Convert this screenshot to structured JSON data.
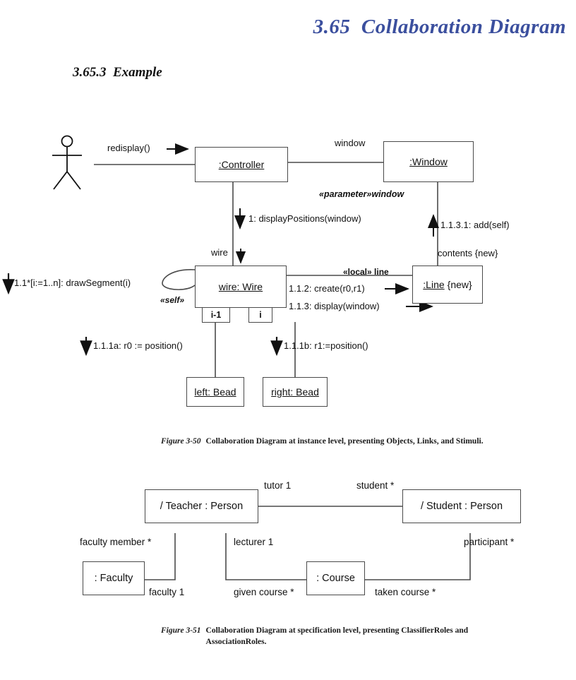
{
  "page": {
    "chapter_title": "3.65  Collaboration Diagram",
    "section_title": "3.65.3  Example",
    "title_color": "#3b4f9e"
  },
  "figure_instance": {
    "actor": {
      "name": "actor-stick-figure"
    },
    "objects": [
      {
        "id": "controller",
        "name": ":Controller",
        "tag": ""
      },
      {
        "id": "window",
        "name": ":Window",
        "tag": ""
      },
      {
        "id": "wire",
        "name": "wire: Wire",
        "tag": ""
      },
      {
        "id": "line",
        "name": ":Line",
        "tag": "{new}"
      },
      {
        "id": "left_bead",
        "name": "left: Bead",
        "tag": ""
      },
      {
        "id": "right_bead",
        "name": "right: Bead",
        "tag": ""
      }
    ],
    "sub_boxes": [
      {
        "id": "i_minus_1",
        "label": "i-1"
      },
      {
        "id": "i",
        "label": "i"
      }
    ],
    "messages": [
      {
        "id": "m0",
        "text": "redisplay()"
      },
      {
        "id": "m1",
        "text": "1: displayPositions(window)"
      },
      {
        "id": "m2",
        "text": "1.1*[i:=1..n]: drawSegment(i)"
      },
      {
        "id": "m3",
        "text": "1.1.1a: r0 := position()"
      },
      {
        "id": "m4",
        "text": "1.1.1b: r1:=position()"
      },
      {
        "id": "m5",
        "text": "1.1.2: create(r0,r1)"
      },
      {
        "id": "m6",
        "text": "1.1.3: display(window)"
      },
      {
        "id": "m7",
        "text": "1.1.3.1: add(self)"
      }
    ],
    "link_labels": [
      {
        "id": "l_window",
        "text": "window"
      },
      {
        "id": "l_parameter_window",
        "text": "«parameter»window"
      },
      {
        "id": "l_wire",
        "text": "wire"
      },
      {
        "id": "l_self",
        "text": "«self»"
      },
      {
        "id": "l_local_line",
        "text": "«local» line"
      },
      {
        "id": "l_contents_new",
        "text": "contents {new}"
      }
    ],
    "caption_label": "Figure 3-50",
    "caption_text": "Collaboration Diagram at instance level, presenting Objects, Links, and Stimuli."
  },
  "figure_spec": {
    "roles": [
      {
        "id": "teacher",
        "name": "/ Teacher : Person"
      },
      {
        "id": "student",
        "name": "/ Student : Person"
      },
      {
        "id": "faculty",
        "name": ": Faculty"
      },
      {
        "id": "course",
        "name": ": Course"
      }
    ],
    "association_roles": [
      {
        "id": "tutor",
        "text": "tutor 1"
      },
      {
        "id": "student_role",
        "text": "student *"
      },
      {
        "id": "faculty_member",
        "text": "faculty member *"
      },
      {
        "id": "lecturer",
        "text": "lecturer 1"
      },
      {
        "id": "participant",
        "text": "participant *"
      },
      {
        "id": "faculty_1",
        "text": "faculty 1"
      },
      {
        "id": "given_course",
        "text": "given course *"
      },
      {
        "id": "taken_course",
        "text": "taken course *"
      }
    ],
    "caption_label": "Figure 3-51",
    "caption_text": "Collaboration Diagram at specification level, presenting ClassifierRoles and AssociationRoles."
  }
}
